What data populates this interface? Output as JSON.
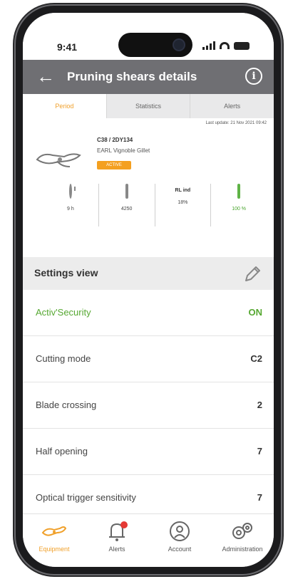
{
  "status_bar": {
    "time": "9:41"
  },
  "app_bar": {
    "title": "Pruning shears details"
  },
  "tabs": [
    {
      "label": "Period",
      "active": true
    },
    {
      "label": "Statistics",
      "active": false
    },
    {
      "label": "Alerts",
      "active": false
    }
  ],
  "detail": {
    "last_update": "Last update: 21 Nov 2021 09:42",
    "model": "C38 / 2DY134",
    "owner": "EARL Vignoble Gillet",
    "badge": "ACTIVE",
    "stats": [
      {
        "icon": "clock-icon",
        "value": "9 h"
      },
      {
        "icon": "blade-icon",
        "value": "4250"
      },
      {
        "label": "RL ind",
        "value": "18%"
      },
      {
        "icon": "battery-icon",
        "value": "100 %"
      }
    ]
  },
  "settings": {
    "title": "Settings view",
    "rows": [
      {
        "label": "Activ'Security",
        "value": "ON",
        "highlight": true
      },
      {
        "label": "Cutting mode",
        "value": "C2"
      },
      {
        "label": "Blade crossing",
        "value": "2"
      },
      {
        "label": "Half opening",
        "value": "7"
      },
      {
        "label": "Optical trigger sensitivity",
        "value": "7"
      }
    ]
  },
  "bottom_nav": [
    {
      "label": "Equipment",
      "icon": "shears-icon",
      "active": true
    },
    {
      "label": "Alerts",
      "icon": "bell-icon",
      "active": false
    },
    {
      "label": "Account",
      "icon": "account-icon",
      "active": false
    },
    {
      "label": "Administration",
      "icon": "gear-icon",
      "active": false
    }
  ],
  "colors": {
    "accent": "#f0a02a",
    "green": "#56a832",
    "appbar": "#6f6f73"
  }
}
